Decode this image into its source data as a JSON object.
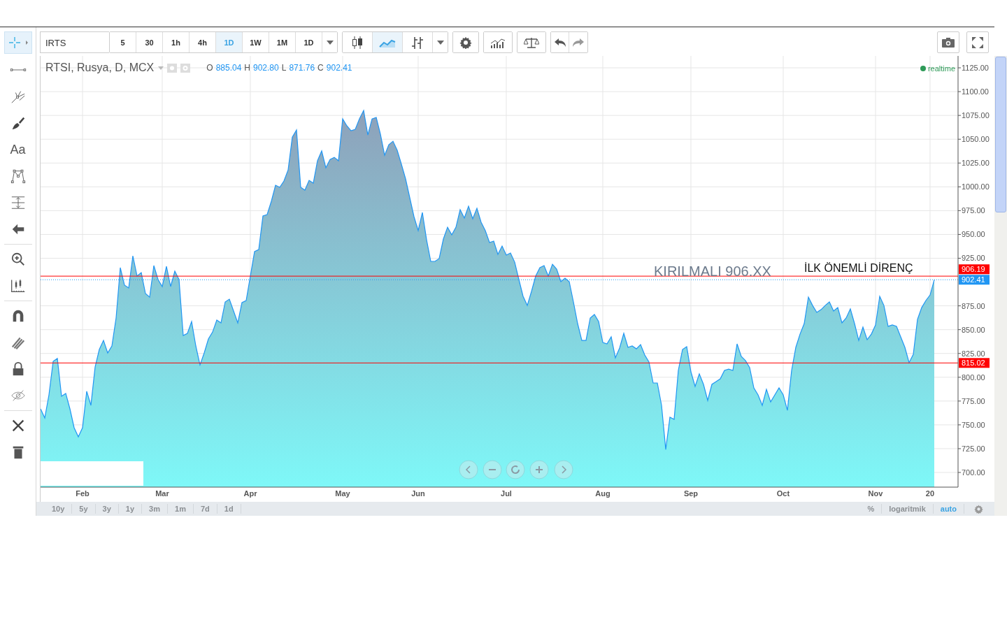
{
  "sidebar": {
    "tool_groups": [
      [
        {
          "kind": "crosshair",
          "selected": true
        },
        {
          "kind": "trend-line",
          "selected": false
        },
        {
          "kind": "pitchfork",
          "selected": false
        },
        {
          "kind": "brush",
          "selected": false
        },
        {
          "kind": "text",
          "label": "Aa",
          "selected": false
        },
        {
          "kind": "pattern",
          "selected": false
        },
        {
          "kind": "measure",
          "selected": false
        },
        {
          "kind": "arrow",
          "selected": false
        }
      ],
      [
        {
          "kind": "zoom",
          "selected": false
        },
        {
          "kind": "ruler",
          "selected": false
        }
      ],
      [
        {
          "kind": "magnet",
          "selected": false
        },
        {
          "kind": "pencils",
          "selected": false
        },
        {
          "kind": "lock",
          "selected": false
        },
        {
          "kind": "eye-off",
          "selected": false
        }
      ],
      [
        {
          "kind": "tools",
          "selected": false
        },
        {
          "kind": "trash",
          "selected": false
        }
      ]
    ]
  },
  "toolbar": {
    "symbol": "IRTS",
    "intervals": [
      {
        "label": "5",
        "selected": false
      },
      {
        "label": "30",
        "selected": false
      },
      {
        "label": "1h",
        "selected": false
      },
      {
        "label": "4h",
        "selected": false
      },
      {
        "label": "1D",
        "selected": true
      },
      {
        "label": "1W",
        "selected": false
      },
      {
        "label": "1M",
        "selected": false
      },
      {
        "label": "1D",
        "selected": false
      }
    ],
    "chart_types": [
      {
        "kind": "candles",
        "selected": false
      },
      {
        "kind": "area",
        "selected": true
      },
      {
        "kind": "bars",
        "selected": false
      }
    ]
  },
  "legend": {
    "title": "RTSI, Rusya, D, MCX",
    "ohlc": [
      {
        "key": "O",
        "value": "885.04"
      },
      {
        "key": "H",
        "value": "902.80"
      },
      {
        "key": "L",
        "value": "871.76"
      },
      {
        "key": "C",
        "value": "902.41"
      }
    ],
    "status": "realtime"
  },
  "chart_data": {
    "type": "area",
    "categories": [
      null,
      null,
      null,
      null,
      null,
      null,
      null,
      null,
      null,
      null,
      "Feb",
      null,
      null,
      null,
      null,
      null,
      null,
      null,
      null,
      null,
      null,
      null,
      null,
      null,
      null,
      null,
      null,
      null,
      null,
      "Mar",
      null,
      null,
      null,
      null,
      null,
      null,
      null,
      null,
      null,
      null,
      null,
      null,
      null,
      null,
      null,
      null,
      null,
      null,
      null,
      null,
      "Apr",
      null,
      null,
      null,
      null,
      null,
      null,
      null,
      null,
      null,
      null,
      null,
      null,
      null,
      null,
      null,
      null,
      null,
      null,
      null,
      null,
      null,
      "May",
      null,
      null,
      null,
      null,
      null,
      null,
      null,
      null,
      null,
      null,
      null,
      null,
      null,
      null,
      null,
      null,
      null,
      "Jun",
      null,
      null,
      null,
      null,
      null,
      null,
      null,
      null,
      null,
      null,
      null,
      null,
      null,
      null,
      null,
      null,
      null,
      null,
      null,
      null,
      "Jul",
      null,
      null,
      null,
      null,
      null,
      null,
      null,
      null,
      null,
      null,
      null,
      null,
      null,
      null,
      null,
      null,
      null,
      null,
      null,
      null,
      null,
      null,
      "Aug",
      null,
      null,
      null,
      null,
      null,
      null,
      null,
      null,
      null,
      null,
      null,
      null,
      null,
      null,
      null,
      null,
      null,
      null,
      null,
      null,
      "Sep",
      null,
      null,
      null,
      null,
      null,
      null,
      null,
      null,
      null,
      null,
      null,
      null,
      null,
      null,
      null,
      null,
      null,
      null,
      null,
      null,
      null,
      "Oct",
      null,
      null,
      null,
      null,
      null,
      null,
      null,
      null,
      null,
      null,
      null,
      null,
      null,
      null,
      null,
      null,
      null,
      null,
      null,
      null,
      null,
      "Nov",
      null,
      null,
      null,
      null,
      null,
      null,
      null,
      null,
      null,
      null,
      null,
      null,
      "20",
      null
    ],
    "series": [
      {
        "color": "#2196f3",
        "values": [
          766.8,
          757.3,
          781.5,
          816.7,
          819.7,
          780.0,
          783.0,
          766.8,
          747.0,
          737.4,
          747.0,
          785.2,
          770.5,
          810.8,
          829.2,
          838.7,
          825.5,
          832.9,
          862.2,
          915.1,
          896.7,
          893.8,
          927.6,
          906.3,
          909.9,
          887.9,
          884.2,
          917.3,
          902.6,
          895.3,
          916.5,
          895.3,
          911.4,
          902.6,
          843.9,
          846.1,
          858.6,
          832.9,
          813.0,
          825.5,
          840.2,
          847.5,
          860.0,
          857.1,
          879.1,
          882.0,
          869.6,
          857.1,
          878.4,
          880.6,
          906.3,
          932.0,
          934.2,
          969.4,
          970.9,
          984.8,
          1001.7,
          999.5,
          1006.1,
          1017.8,
          1052.3,
          1059.7,
          999.5,
          996.5,
          1006.8,
          1003.9,
          1027.4,
          1037.7,
          1020.0,
          1028.8,
          1031.0,
          1027.4,
          1071.4,
          1064.1,
          1058.9,
          1060.4,
          1071.4,
          1080.2,
          1054.5,
          1071.4,
          1072.9,
          1055.3,
          1033.2,
          1044.3,
          1047.9,
          1038.4,
          1023.7,
          1008.3,
          988.5,
          968.7,
          954.0,
          973.1,
          944.4,
          921.7,
          921.7,
          924.6,
          945.2,
          957.6,
          949.6,
          957.6,
          976.0,
          967.2,
          979.7,
          966.5,
          977.5,
          962.8,
          954.0,
          941.5,
          943.0,
          929.0,
          937.8,
          928.3,
          930.5,
          920.9,
          902.6,
          885.0,
          875.4,
          890.1,
          906.3,
          915.1,
          917.3,
          906.3,
          918.7,
          913.6,
          900.4,
          904.1,
          900.4,
          879.1,
          856.4,
          838.7,
          838.7,
          862.2,
          865.9,
          858.6,
          836.5,
          835.1,
          842.4,
          820.4,
          830.7,
          846.1,
          831.4,
          832.9,
          829.9,
          834.3,
          823.3,
          816.0,
          794.0,
          794.0,
          770.5,
          724.2,
          758.0,
          755.8,
          807.2,
          829.2,
          832.1,
          805.7,
          790.3,
          803.5,
          792.5,
          775.6,
          792.5,
          795.4,
          798.4,
          807.2,
          808.6,
          807.2,
          835.1,
          821.9,
          817.5,
          810.1,
          788.8,
          781.5,
          770.5,
          787.4,
          774.1,
          781.5,
          788.8,
          781.5,
          765.3,
          807.2,
          831.4,
          845.3,
          856.4,
          884.2,
          875.4,
          868.1,
          871.0,
          875.4,
          879.1,
          869.6,
          873.2,
          857.1,
          862.2,
          871.8,
          856.4,
          838.7,
          852.7,
          839.5,
          845.3,
          854.9,
          885.0,
          875.4,
          853.4,
          854.9,
          853.4,
          842.4,
          831.4,
          815.3,
          824.1,
          860.8,
          873.2,
          880.6,
          886.4,
          902.4
        ]
      }
    ],
    "ylim": [
      684.6,
      1137.5
    ],
    "yticks": [
      {
        "value": 700,
        "label": "700.00"
      },
      {
        "value": 725,
        "label": "725.00"
      },
      {
        "value": 750,
        "label": "750.00"
      },
      {
        "value": 775,
        "label": "775.00"
      },
      {
        "value": 800,
        "label": "800.00"
      },
      {
        "value": 825,
        "label": "825.00"
      },
      {
        "value": 850,
        "label": "850.00"
      },
      {
        "value": 875,
        "label": "875.00"
      },
      {
        "value": 925,
        "label": "925.00"
      },
      {
        "value": 950,
        "label": "950.00"
      },
      {
        "value": 975,
        "label": "975.00"
      },
      {
        "value": 1000,
        "label": "1000.00"
      },
      {
        "value": 1025,
        "label": "1025.00"
      },
      {
        "value": 1050,
        "label": "1050.00"
      },
      {
        "value": 1075,
        "label": "1075.00"
      },
      {
        "value": 1100,
        "label": "1100.00"
      },
      {
        "value": 1125,
        "label": "1125.00"
      }
    ],
    "grid": true,
    "ref_lines": [
      {
        "axis": "y",
        "value": 906.19,
        "label": "906.19",
        "color": "#ff0000"
      },
      {
        "axis": "y",
        "value": 902.41,
        "label": "902.41",
        "color": "#2196f3"
      },
      {
        "axis": "y",
        "value": 815.02,
        "label": "815.02",
        "color": "#ff0000"
      }
    ],
    "annotations": [
      "KIRILMALI 906.XX",
      "İLK ÖNEMLİ DİRENÇ"
    ]
  },
  "bottom_bar": {
    "ranges": [
      "10y",
      "5y",
      "3y",
      "1y",
      "3m",
      "1m",
      "7d",
      "1d"
    ],
    "scale_options": [
      {
        "label": "%",
        "selected": false
      },
      {
        "label": "logaritmik",
        "selected": false
      },
      {
        "label": "auto",
        "selected": true
      }
    ]
  }
}
